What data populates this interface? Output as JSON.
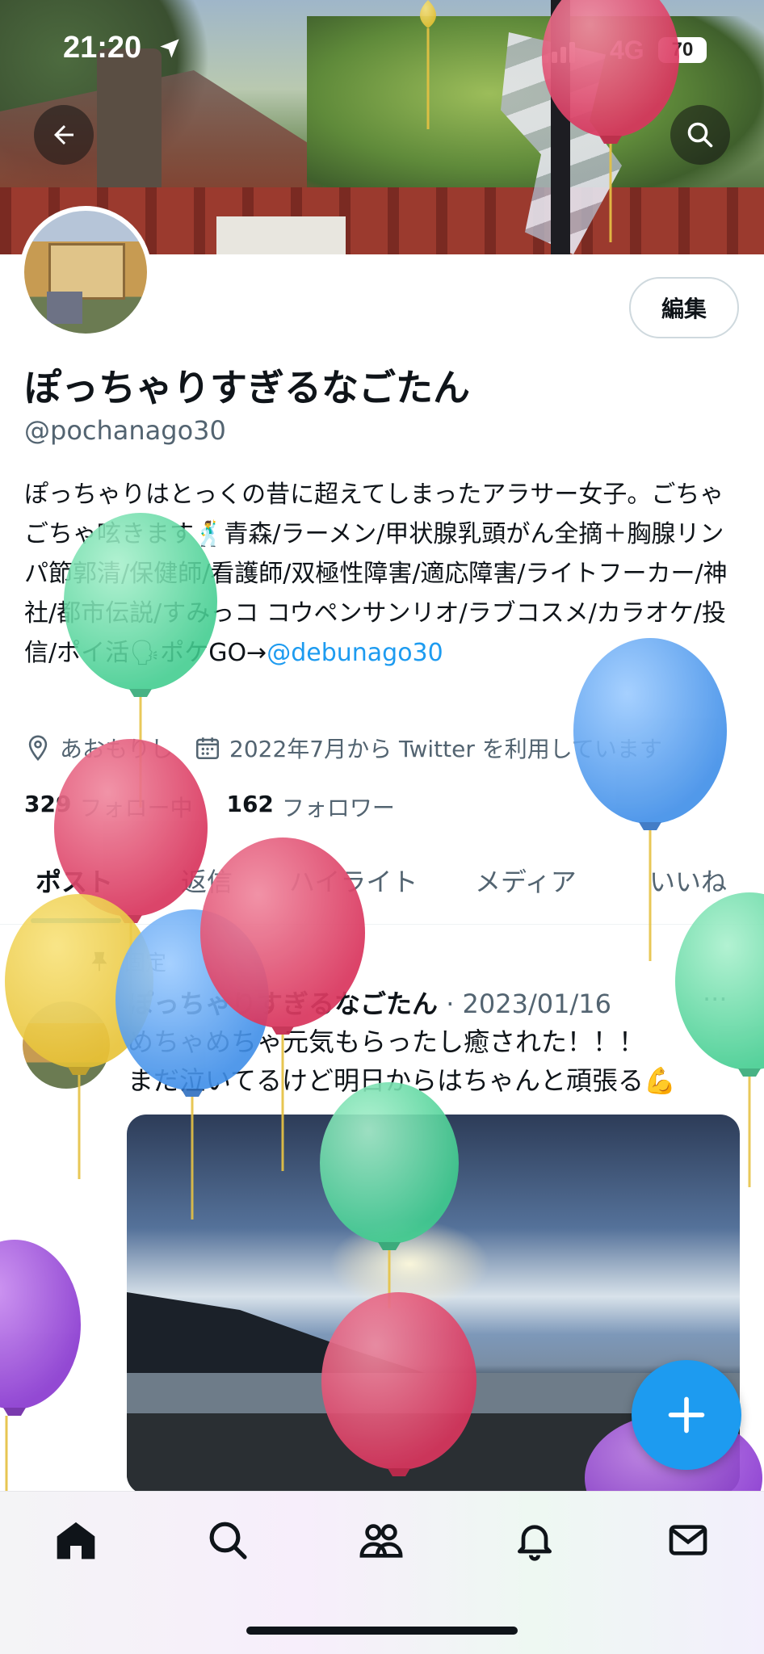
{
  "status_bar": {
    "time": "21:20",
    "network": "4G",
    "battery": "70"
  },
  "profile": {
    "edit_label": "編集",
    "display_name": "ぽっちゃりすぎるなごたん",
    "handle": "@pochanago30",
    "bio_text": "ぽっちゃりはとっくの昔に超えてしまったアラサー女子。ごちゃごちゃ呟きます🕺青森/ラーメン/甲状腺乳頭がん全摘＋胸腺リンパ節郭清/保健師/看護師/双極性障害/適応障害/ライトフーカー/神社/都市伝説/すみっコ コウペンサンリオ/ラブコスメ/カラオケ/投信/ポイ活🗣ポケGO→",
    "bio_mention": "@debunago30",
    "location": "あおもりし",
    "joined": "2022年7月から Twitter を利用しています",
    "following_count": "329",
    "following_label": "フォロー中",
    "followers_count": "162",
    "followers_label": "フォロワー"
  },
  "tabs": [
    "ポスト",
    "返信",
    "ハイライト",
    "メディア",
    "いいね"
  ],
  "pinned_post": {
    "pinned_label": "固定",
    "author": "ぽっちゃりすぎるなごたん",
    "date": "· 2023/01/16",
    "more": "···",
    "line1": "めちゃめちゃ元気もらったし癒された！！！",
    "line2": "まだ泣いてるけど明日からはちゃんと頑張る💪"
  },
  "colors": {
    "accent": "#1d9bf0",
    "text": "#0f1419",
    "secondary": "#536471"
  },
  "icons": [
    "back-arrow-icon",
    "search-icon",
    "location-pin-icon",
    "calendar-icon",
    "pin-icon",
    "plus-icon",
    "home-icon",
    "explore-icon",
    "communities-icon",
    "bell-icon",
    "mail-icon"
  ]
}
